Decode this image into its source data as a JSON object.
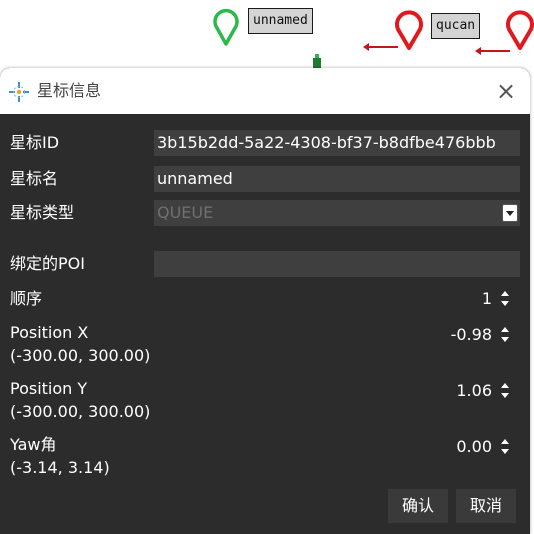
{
  "map": {
    "markers": [
      {
        "label": "unnamed",
        "color": "#2db84a"
      },
      {
        "label": "qucan",
        "color": "#e0191e"
      },
      {
        "label": "",
        "color": "#e0191e"
      }
    ]
  },
  "dialog": {
    "title": "星标信息",
    "close_glyph": "×",
    "fields": {
      "id": {
        "label": "星标ID",
        "value": "3b15b2dd-5a22-4308-bf37-b8dfbe476bbb"
      },
      "name": {
        "label": "星标名",
        "value": "unnamed"
      },
      "type": {
        "label": "星标类型",
        "value": "QUEUE"
      },
      "poi": {
        "label": "绑定的POI",
        "value": ""
      },
      "order": {
        "label": "顺序",
        "value": "1"
      },
      "pos_x": {
        "label": "Position X",
        "range": "(-300.00, 300.00)",
        "value": "-0.98"
      },
      "pos_y": {
        "label": "Position Y",
        "range": "(-300.00, 300.00)",
        "value": "1.06"
      },
      "yaw": {
        "label": "Yaw角",
        "range": "(-3.14, 3.14)",
        "value": "0.00"
      }
    },
    "buttons": {
      "confirm": "确认",
      "cancel": "取消"
    }
  },
  "colors": {
    "dialog_bg": "#2c2c2c",
    "field_bg": "#3f3f3f",
    "pin_green": "#2db84a",
    "pin_red": "#e0191e",
    "accent_blue": "#3b8fd8"
  }
}
